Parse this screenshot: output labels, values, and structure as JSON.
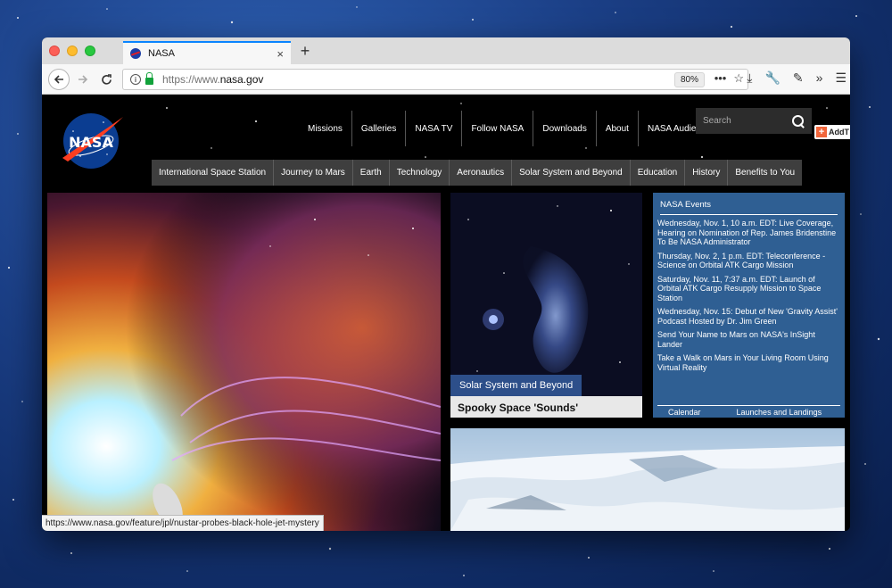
{
  "browser": {
    "tab_title": "NASA",
    "tab_close": "×",
    "new_tab": "+",
    "url_prefix": "https://www.",
    "url_domain": "nasa.gov",
    "zoom": "80%",
    "more_actions": "•••",
    "icons": [
      "back-icon",
      "forward-icon",
      "reload-icon",
      "info-icon",
      "lock-icon",
      "bookmark-star-icon",
      "download-icon",
      "wrench-icon",
      "pin-icon",
      "overflow-icon",
      "menu-icon"
    ]
  },
  "site": {
    "top_nav": [
      "Missions",
      "Galleries",
      "NASA TV",
      "Follow NASA",
      "Downloads",
      "About",
      "NASA Audiences"
    ],
    "search_placeholder": "Search",
    "addthis_label": "AddT",
    "addthis_plus": "+",
    "sub_nav": [
      "International Space Station",
      "Journey to Mars",
      "Earth",
      "Technology",
      "Aeronautics",
      "Solar System and Beyond",
      "Education",
      "History",
      "Benefits to You"
    ],
    "feature_card": {
      "category": "Solar System and Beyond",
      "title": "Spooky Space 'Sounds'"
    },
    "events": {
      "heading": "NASA Events",
      "items": [
        "Wednesday, Nov. 1, 10 a.m. EDT: Live Coverage, Hearing on Nomination of Rep. James Bridenstine To Be NASA Administrator",
        "Thursday, Nov. 2, 1 p.m. EDT: Teleconference - Science on Orbital ATK Cargo Mission",
        "Saturday, Nov. 11, 7:37 a.m. EDT: Launch of Orbital ATK Cargo Resupply Mission to Space Station",
        "Wednesday, Nov. 15: Debut of New 'Gravity Assist' Podcast Hosted by Dr. Jim Green",
        "Send Your Name to Mars on NASA's InSight Lander",
        "Take a Walk on Mars in Your Living Room Using Virtual Reality"
      ],
      "footer": [
        "Calendar",
        "Launches and Landings"
      ]
    },
    "status_url": "https://www.nasa.gov/feature/jpl/nustar-probes-black-hole-jet-mystery"
  },
  "colors": {
    "accent_tab": "#0a84ff",
    "events_bg": "#2f5f93",
    "category_bg": "#2d4f8a",
    "nasa_blue": "#0b3d91",
    "nasa_red": "#fc3d21"
  }
}
